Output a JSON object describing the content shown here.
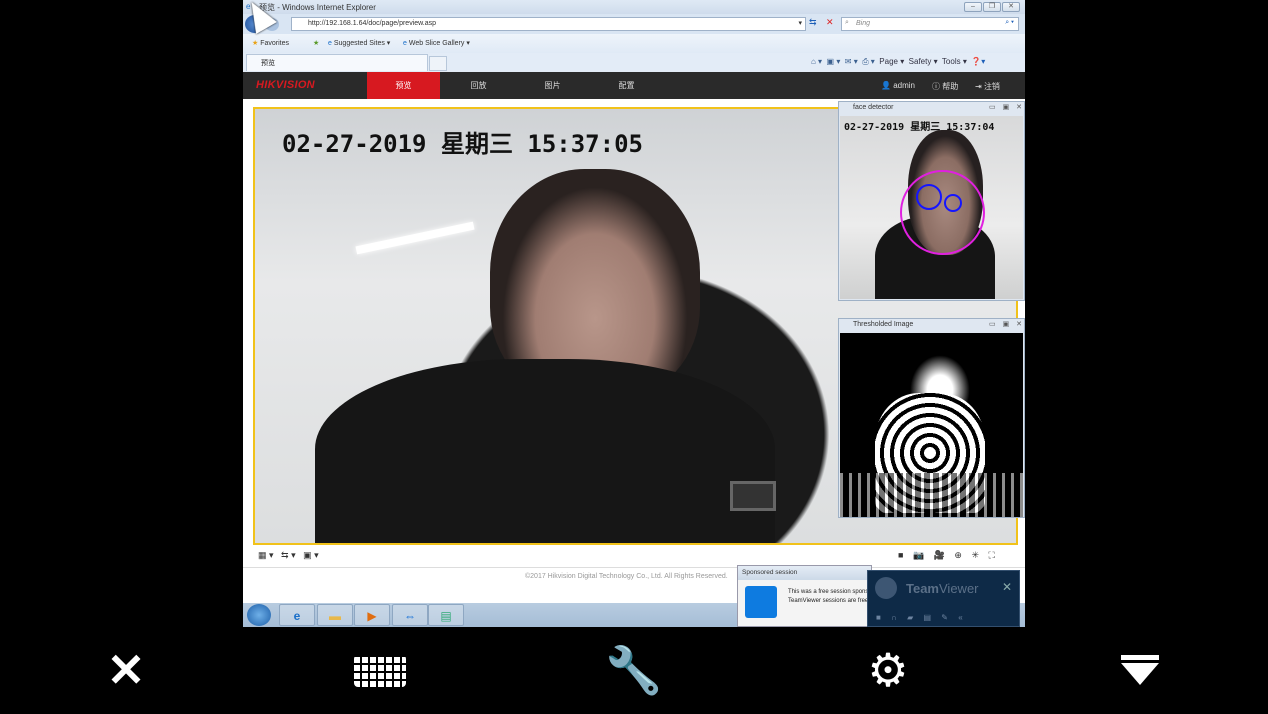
{
  "browser": {
    "title": "预览 - Windows Internet Explorer",
    "url": "http://192.168.1.64/doc/page/preview.asp",
    "search_placeholder": "Bing",
    "favorites": "Favorites",
    "suggested": "Suggested Sites",
    "webslice": "Web Slice Gallery",
    "tab": "预览",
    "cmd": {
      "page": "Page",
      "safety": "Safety",
      "tools": "Tools"
    }
  },
  "app": {
    "logo": "HIKVISION",
    "nav": [
      {
        "label": "预览",
        "active": true
      },
      {
        "label": "回放"
      },
      {
        "label": "图片"
      },
      {
        "label": "配置"
      }
    ],
    "user": "admin",
    "help": "帮助",
    "logout": "注销",
    "osd": "02-27-2019 星期三 15:37:05",
    "footer": "©2017 Hikvision Digital Technology Co., Ltd. All Rights Reserved."
  },
  "face_window": {
    "title": "face detector",
    "osd": "02-27-2019 星期三 15:37:04"
  },
  "thresh_window": {
    "title": "Thresholded Image"
  },
  "sponsored": {
    "title": "Sponsored session",
    "line1": "This was a free session sponsored",
    "line2": "TeamViewer sessions are free"
  },
  "teamviewer": {
    "name_bold": "Team",
    "name_light": "Viewer"
  },
  "colors": {
    "accent": "#d71920",
    "video_border": "#f1c21a",
    "teamviewer": "#0e2a47"
  }
}
